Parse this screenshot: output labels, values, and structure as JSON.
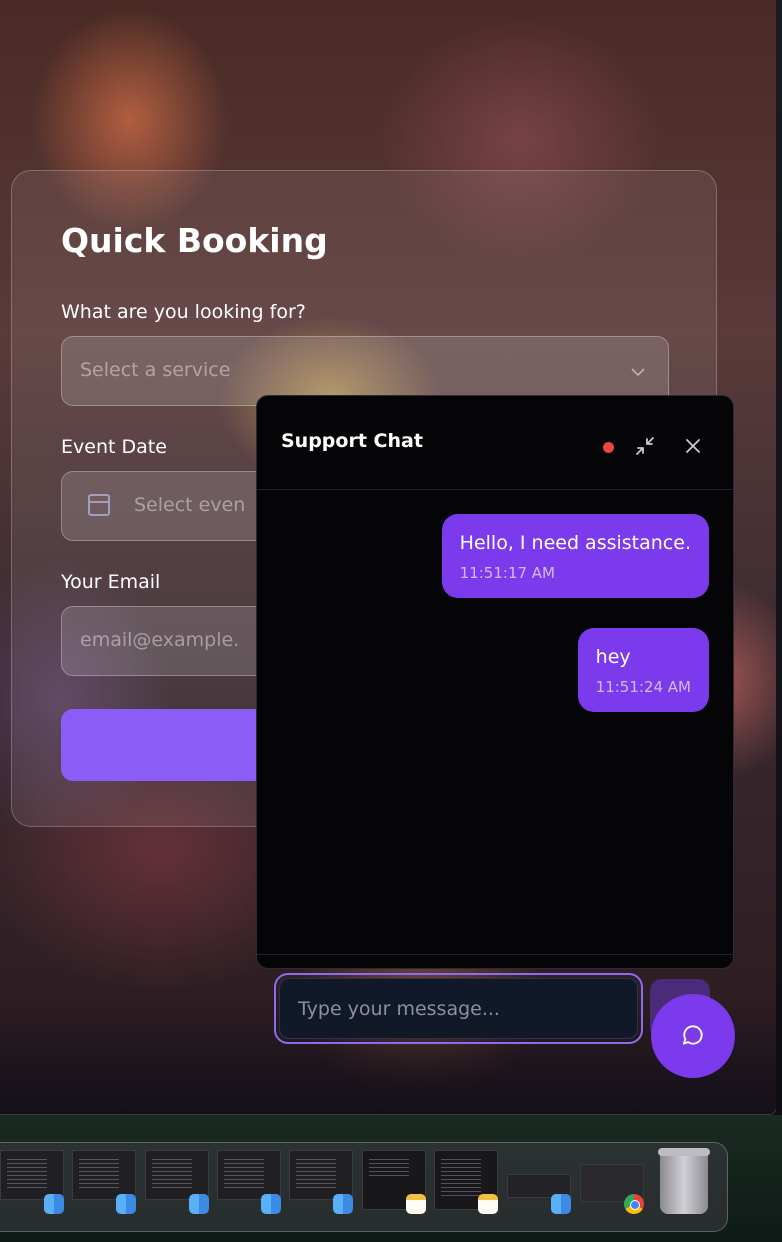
{
  "booking": {
    "title": "Quick Booking",
    "service_label": "What are you looking for?",
    "service_placeholder": "Select a service",
    "date_label": "Event Date",
    "date_placeholder": "Select even",
    "email_label": "Your Email",
    "email_placeholder": "email@example."
  },
  "chat": {
    "title": "Support Chat",
    "status_color": "#ef4444",
    "messages": [
      {
        "text": "Hello, I need assistance.",
        "time": "11:51:17 AM"
      },
      {
        "text": "hey",
        "time": "11:51:24 AM"
      }
    ],
    "input_placeholder": "Type your message...",
    "accent": "#7c3aed"
  },
  "dock": {
    "items": [
      "finder-window",
      "finder-window",
      "finder-window",
      "finder-window",
      "finder-window",
      "notes-window",
      "notes-window",
      "finder-window",
      "chrome-window",
      "trash"
    ]
  }
}
